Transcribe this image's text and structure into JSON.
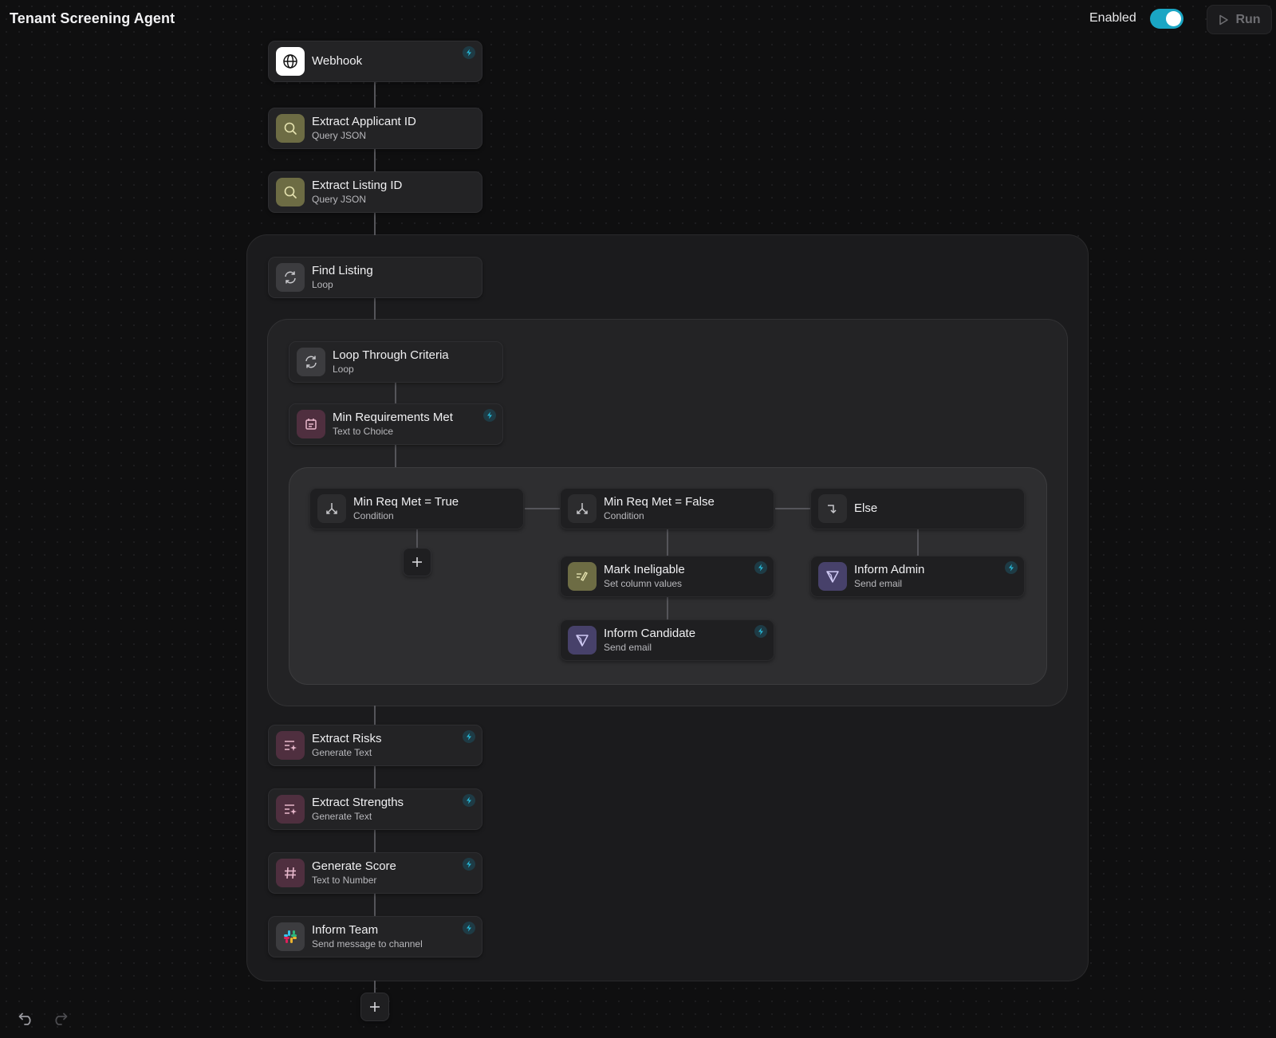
{
  "header": {
    "title": "Tenant Screening Agent",
    "enabled_label": "Enabled",
    "enabled": true,
    "run_label": "Run",
    "accent_color": "#1aa6c4"
  },
  "nodes": {
    "webhook": {
      "name": "Webhook",
      "icon": "globe-icon",
      "has_bolt": true
    },
    "extract_applicant_id": {
      "name": "Extract Applicant ID",
      "sub": "Query JSON",
      "icon": "search-icon"
    },
    "extract_listing_id": {
      "name": "Extract Listing ID",
      "sub": "Query JSON",
      "icon": "search-icon"
    },
    "find_listing": {
      "name": "Find Listing",
      "sub": "Loop",
      "icon": "loop-icon"
    },
    "loop_through_criteria": {
      "name": "Loop Through Criteria",
      "sub": "Loop",
      "icon": "loop-icon"
    },
    "min_requirements_met": {
      "name": "Min Requirements Met",
      "sub": "Text to Choice",
      "icon": "choice-icon",
      "has_bolt": true
    },
    "cond_true": {
      "name": "Min Req Met = True",
      "sub": "Condition",
      "icon": "branch-icon"
    },
    "cond_false": {
      "name": "Min Req Met = False",
      "sub": "Condition",
      "icon": "branch-icon"
    },
    "cond_else": {
      "name": "Else",
      "icon": "else-arrow-icon"
    },
    "mark_ineligable": {
      "name": "Mark Ineligable",
      "sub": "Set column values",
      "icon": "pencil-icon",
      "has_bolt": true
    },
    "inform_candidate": {
      "name": "Inform Candidate",
      "sub": "Send email",
      "icon": "send-icon",
      "has_bolt": true
    },
    "inform_admin": {
      "name": "Inform Admin",
      "sub": "Send email",
      "icon": "send-icon",
      "has_bolt": true
    },
    "extract_risks": {
      "name": "Extract Risks",
      "sub": "Generate Text",
      "icon": "generate-text-icon",
      "has_bolt": true
    },
    "extract_strengths": {
      "name": "Extract Strengths",
      "sub": "Generate Text",
      "icon": "generate-text-icon",
      "has_bolt": true
    },
    "generate_score": {
      "name": "Generate Score",
      "sub": "Text to Number",
      "icon": "hash-icon",
      "has_bolt": true
    },
    "inform_team": {
      "name": "Inform Team",
      "sub": "Send message to channel",
      "icon": "slack-icon",
      "has_bolt": true
    }
  },
  "footer": {
    "undo_icon": "undo-icon",
    "redo_icon": "redo-icon"
  }
}
